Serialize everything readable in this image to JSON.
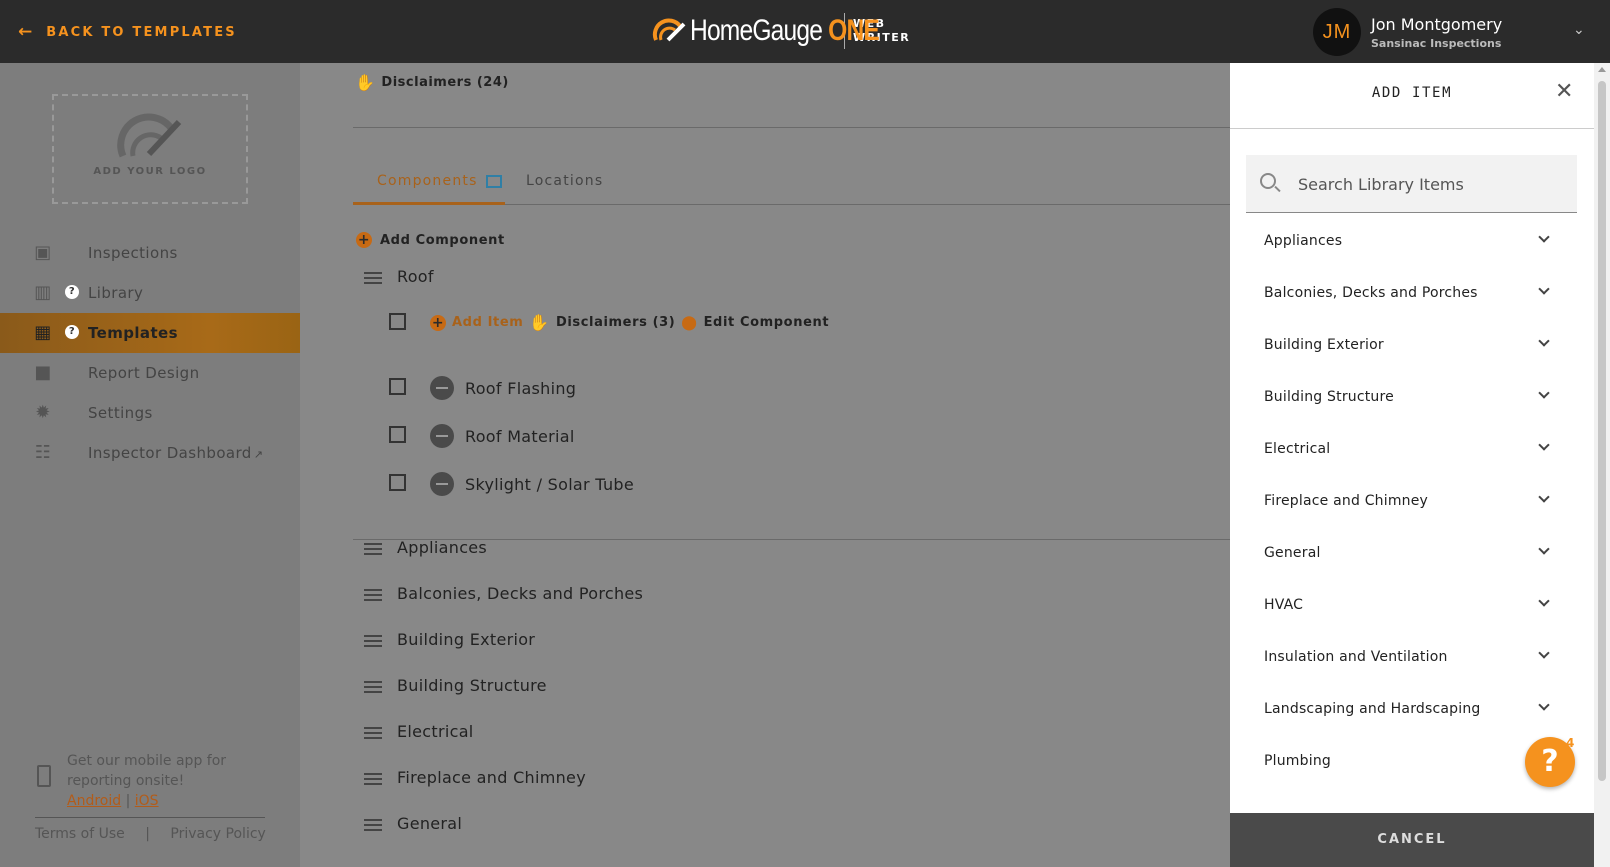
{
  "topbar": {
    "back_label": "BACK TO TEMPLATES",
    "brand_home": "HomeGauge",
    "brand_one": "ONE",
    "brand_web": "WEB",
    "brand_writer": "WRITER",
    "user_initials": "JM",
    "user_name": "Jon Montgomery",
    "company": "Sansinac Inspections"
  },
  "sidebar": {
    "logo_label": "ADD YOUR LOGO",
    "items": [
      {
        "label": "Inspections",
        "icon": "clipboard-check-icon"
      },
      {
        "label": "Library",
        "icon": "book-icon"
      },
      {
        "label": "Templates",
        "icon": "table-icon"
      },
      {
        "label": "Report Design",
        "icon": "folder-icon"
      },
      {
        "label": "Settings",
        "icon": "gear-icon"
      },
      {
        "label": "Inspector Dashboard",
        "icon": "dashboard-icon"
      }
    ],
    "help_badge": "?",
    "mobile_text": "Get our mobile app for reporting onsite!",
    "android": "Android",
    "ios": "iOS",
    "terms": "Terms of Use",
    "privacy": "Privacy Policy"
  },
  "main": {
    "disclaimers_top": "Disclaimers (24)",
    "tabs": [
      "Components",
      "Locations"
    ],
    "add_component": "Add Component",
    "roof": {
      "name": "Roof",
      "add_item": "Add Item",
      "disclaimers": "Disclaimers (3)",
      "edit_component": "Edit Component",
      "items": [
        "Roof Flashing",
        "Roof Material",
        "Skylight / Solar Tube"
      ]
    },
    "components": [
      "Appliances",
      "Balconies, Decks and Porches",
      "Building Exterior",
      "Building Structure",
      "Electrical",
      "Fireplace and Chimney",
      "General"
    ]
  },
  "panel": {
    "title": "ADD ITEM",
    "search_placeholder": "Search Library Items",
    "items": [
      "Appliances",
      "Balconies, Decks and Porches",
      "Building Exterior",
      "Building Structure",
      "Electrical",
      "Fireplace and Chimney",
      "General",
      "HVAC",
      "Insulation and Ventilation",
      "Landscaping and Hardscaping",
      "Plumbing"
    ],
    "cancel": "CANCEL"
  },
  "fab": {
    "label": "?",
    "badge": "4"
  },
  "colors": {
    "accent": "#f5921e",
    "topbar": "#2b2b2b",
    "active_nav": "#a86a18"
  }
}
